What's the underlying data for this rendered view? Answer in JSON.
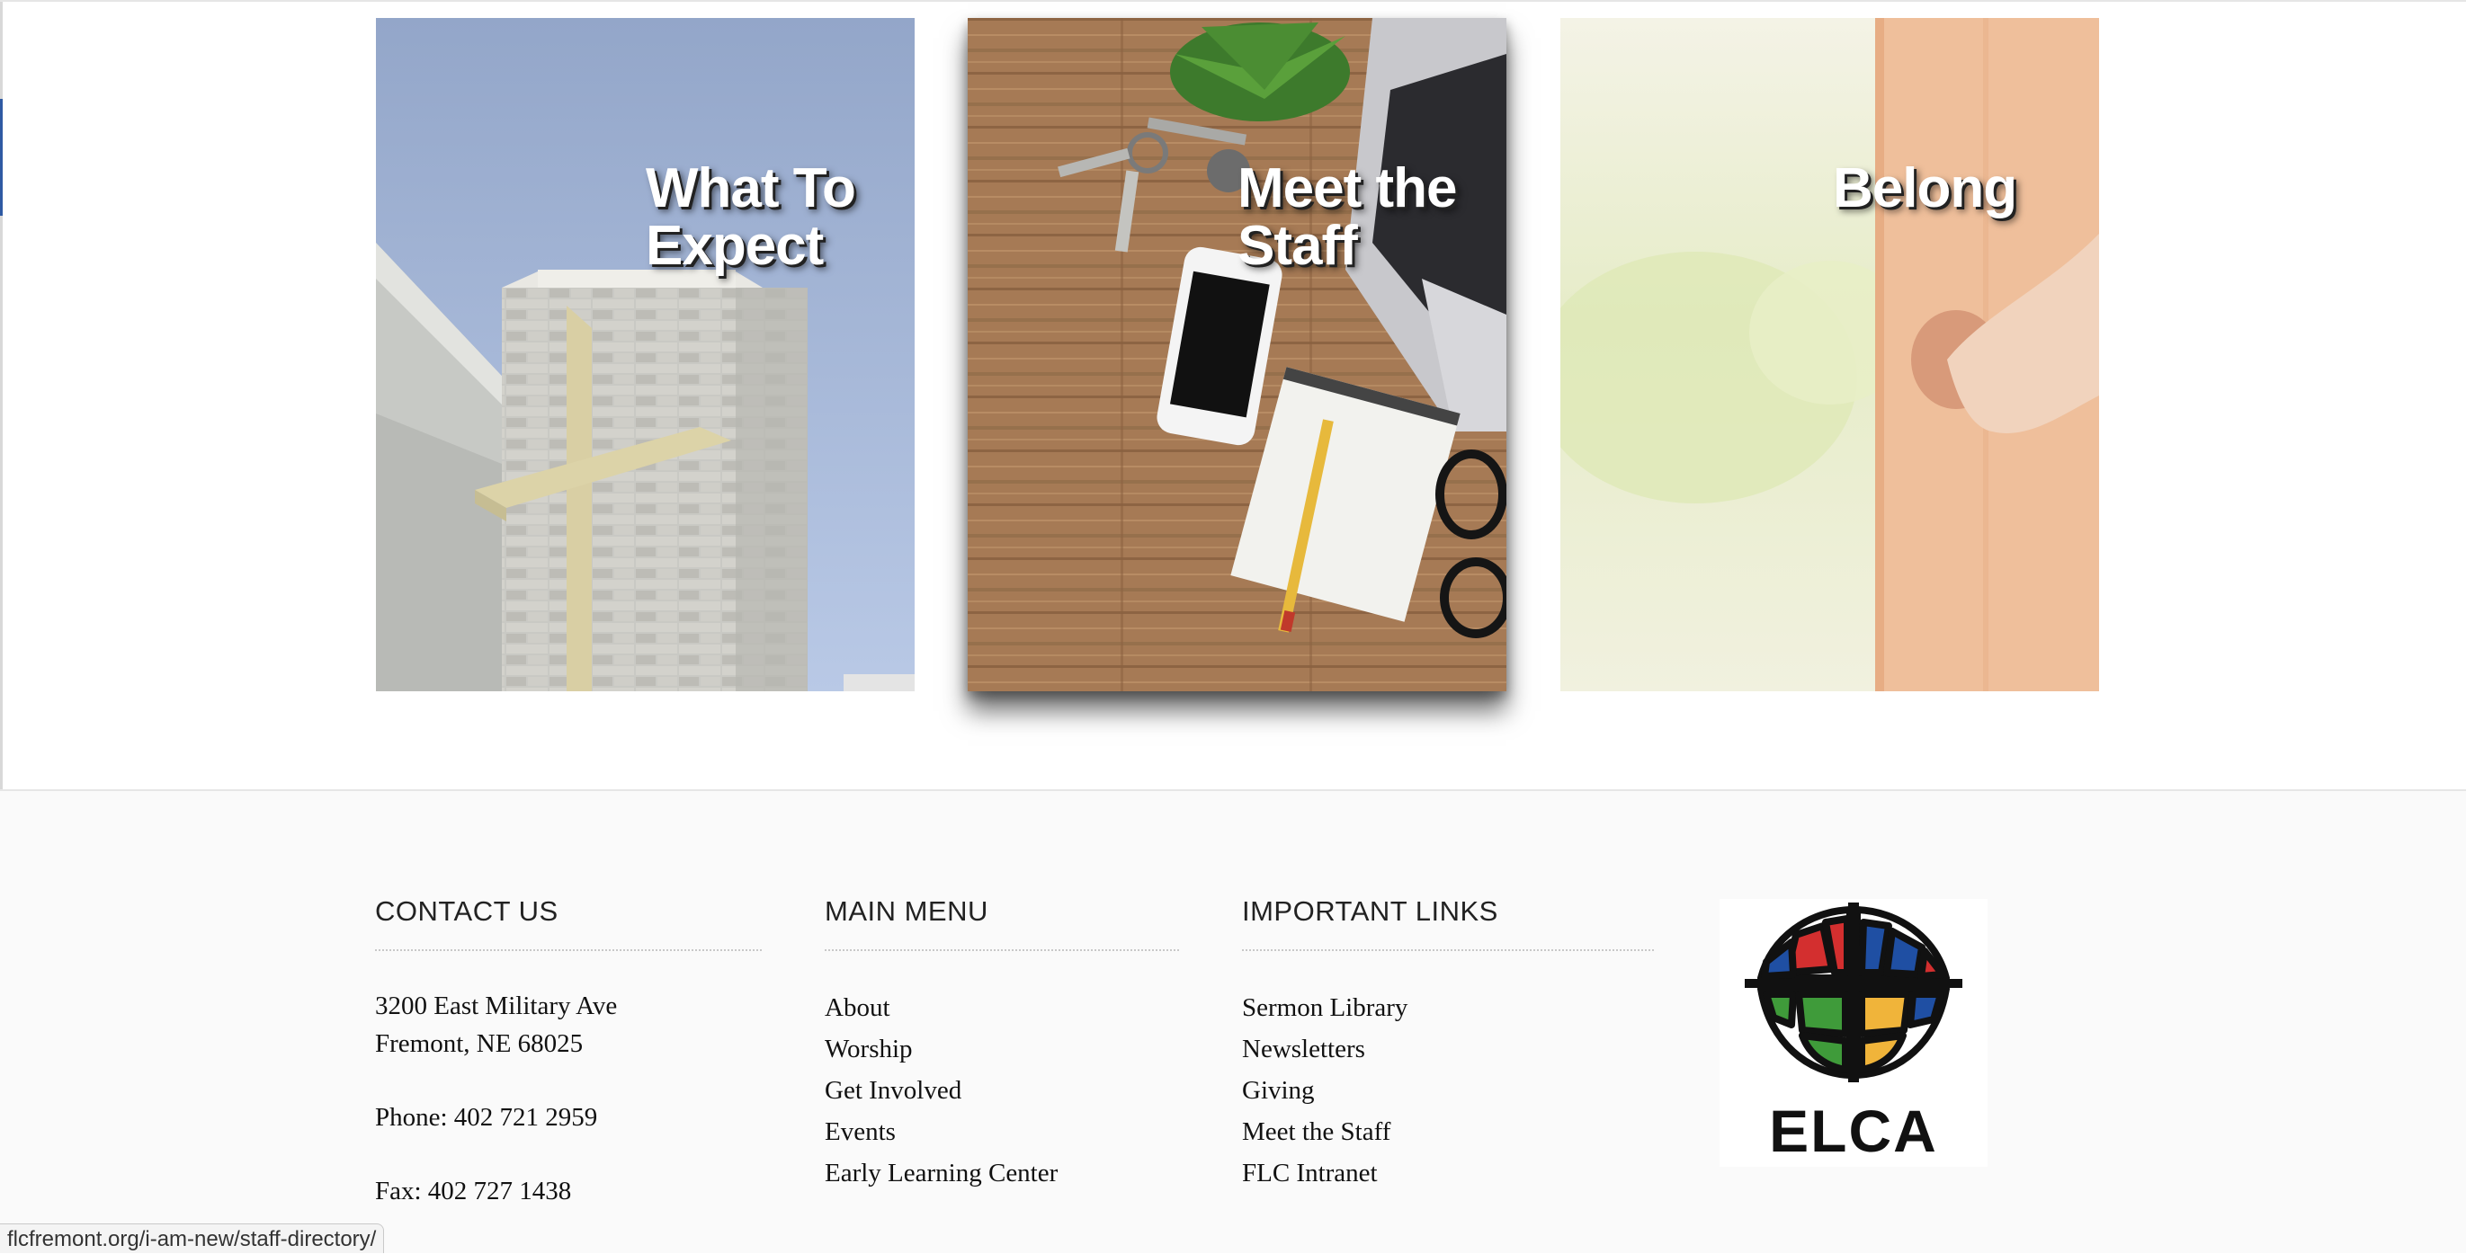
{
  "cards": [
    {
      "title": "What To Expect"
    },
    {
      "title": "Meet the Staff"
    },
    {
      "title": "Belong"
    }
  ],
  "footer": {
    "contact": {
      "heading": "CONTACT US",
      "address_line1": "3200 East Military Ave",
      "address_line2": "Fremont, NE 68025",
      "phone": "Phone: 402 721 2959",
      "fax": "Fax: 402 727 1438"
    },
    "main_menu": {
      "heading": "MAIN MENU",
      "items": [
        "About",
        "Worship",
        "Get Involved",
        "Events",
        "Early Learning Center"
      ]
    },
    "important_links": {
      "heading": "IMPORTANT LINKS",
      "items": [
        "Sermon Library",
        "Newsletters",
        "Giving",
        "Meet the Staff",
        "FLC Intranet"
      ]
    },
    "logo_text": "ELCA"
  },
  "status_bar": {
    "url": "flcfremont.org/i-am-new/staff-directory/"
  },
  "colors": {
    "elca_red": "#d32f2f",
    "elca_blue": "#1f4fa3",
    "elca_green": "#3f9b3a",
    "elca_yellow": "#f0b43a"
  }
}
